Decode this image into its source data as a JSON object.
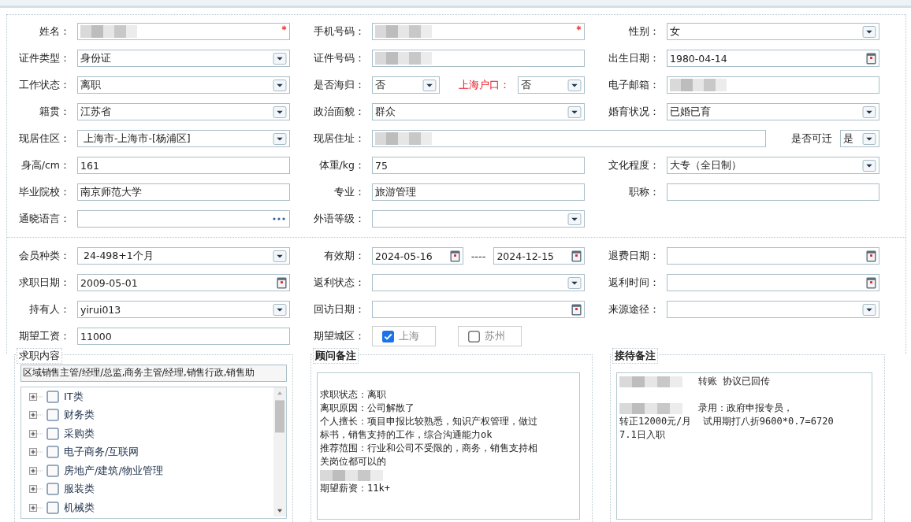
{
  "sections": [
    {
      "rows": [
        {
          "cells": [
            {
              "label": "姓名：",
              "controls": [
                {
                  "kind": "text",
                  "redacted": true,
                  "required": true
                }
              ]
            },
            {
              "label": "手机号码：",
              "controls": [
                {
                  "kind": "text",
                  "redacted": true,
                  "required": true
                }
              ]
            },
            {
              "label": "性别：",
              "controls": [
                {
                  "kind": "select",
                  "value": "女"
                }
              ]
            }
          ]
        },
        {
          "cells": [
            {
              "label": "证件类型：",
              "controls": [
                {
                  "kind": "select",
                  "value": "身份证"
                }
              ]
            },
            {
              "label": "证件号码：",
              "controls": [
                {
                  "kind": "text",
                  "redacted": true
                }
              ]
            },
            {
              "label": "出生日期：",
              "controls": [
                {
                  "kind": "date",
                  "value": "1980-04-14"
                }
              ]
            }
          ]
        },
        {
          "cells": [
            {
              "label": "工作状态：",
              "controls": [
                {
                  "kind": "select",
                  "value": "离职"
                }
              ]
            },
            {
              "label": "是否海归：",
              "controls": [
                {
                  "kind": "select",
                  "value": "否"
                },
                {
                  "kind": "label",
                  "text": "上海户口：",
                  "warning": true
                },
                {
                  "kind": "select",
                  "value": "否"
                }
              ]
            },
            {
              "label": "电子邮箱：",
              "controls": [
                {
                  "kind": "text",
                  "redacted": true
                }
              ]
            }
          ]
        },
        {
          "cells": [
            {
              "label": "籍贯：",
              "controls": [
                {
                  "kind": "select",
                  "value": "江苏省"
                }
              ]
            },
            {
              "label": "政治面貌：",
              "controls": [
                {
                  "kind": "select",
                  "value": "群众"
                }
              ]
            },
            {
              "label": "婚育状况：",
              "controls": [
                {
                  "kind": "select",
                  "value": "已婚已育"
                }
              ]
            }
          ]
        },
        {
          "cells": [
            {
              "label": "现居住区：",
              "controls": [
                {
                  "kind": "select",
                  "value": " 上海市-上海市-[杨浦区]"
                }
              ]
            },
            {
              "label": "现居住址：",
              "wide": true,
              "controls": [
                {
                  "kind": "text",
                  "redacted": true
                },
                {
                  "kind": "label",
                  "text": "是否可迁",
                  "warning": false
                },
                {
                  "kind": "select",
                  "value": "是"
                }
              ]
            }
          ]
        },
        {
          "cells": [
            {
              "label": "身高/cm：",
              "controls": [
                {
                  "kind": "text",
                  "value": "161"
                }
              ]
            },
            {
              "label": "体重/kg：",
              "controls": [
                {
                  "kind": "text",
                  "value": "75"
                }
              ]
            },
            {
              "label": "文化程度：",
              "controls": [
                {
                  "kind": "select",
                  "value": "大专（全日制）"
                }
              ]
            }
          ]
        },
        {
          "cells": [
            {
              "label": "毕业院校：",
              "controls": [
                {
                  "kind": "text",
                  "value": "南京师范大学"
                }
              ]
            },
            {
              "label": "专业：",
              "controls": [
                {
                  "kind": "text",
                  "value": "旅游管理"
                }
              ]
            },
            {
              "label": "职称：",
              "controls": [
                {
                  "kind": "text"
                }
              ]
            }
          ]
        },
        {
          "cells": [
            {
              "label": "通晓语言：",
              "controls": [
                {
                  "kind": "lookup"
                }
              ]
            },
            {
              "label": "外语等级：",
              "controls": [
                {
                  "kind": "select"
                }
              ]
            }
          ]
        }
      ]
    },
    {
      "rows": [
        {
          "cells": [
            {
              "label": "会员种类：",
              "controls": [
                {
                  "kind": "select",
                  "value": " 24-498+1个月"
                }
              ]
            },
            {
              "label": "有效期：",
              "controls": [
                {
                  "kind": "date",
                  "value": "2024-05-16"
                },
                {
                  "kind": "separator",
                  "text": "----"
                },
                {
                  "kind": "date",
                  "value": "2024-12-15"
                }
              ]
            },
            {
              "label": "退费日期：",
              "controls": [
                {
                  "kind": "date"
                }
              ]
            }
          ]
        },
        {
          "cells": [
            {
              "label": "求职日期：",
              "controls": [
                {
                  "kind": "date",
                  "value": "2009-05-01"
                }
              ]
            },
            {
              "label": "返利状态：",
              "controls": [
                {
                  "kind": "select"
                }
              ]
            },
            {
              "label": "返利时间：",
              "controls": [
                {
                  "kind": "date"
                }
              ]
            }
          ]
        },
        {
          "cells": [
            {
              "label": "持有人：",
              "controls": [
                {
                  "kind": "select",
                  "value": "yirui013"
                }
              ]
            },
            {
              "label": "回访日期：",
              "controls": [
                {
                  "kind": "date"
                }
              ]
            },
            {
              "label": "来源途径：",
              "controls": [
                {
                  "kind": "select"
                }
              ]
            }
          ]
        },
        {
          "cells": [
            {
              "label": "期望工资：",
              "controls": [
                {
                  "kind": "text",
                  "value": "11000"
                }
              ]
            },
            {
              "label": "期望城区：",
              "controls": [
                {
                  "kind": "chip",
                  "text": "上海",
                  "checked": true
                },
                {
                  "kind": "chip",
                  "text": "苏州",
                  "checked": false
                }
              ]
            }
          ]
        }
      ]
    }
  ],
  "panels": [
    {
      "kind": "tree",
      "title": "求职内容",
      "summary": "区域销售主管/经理/总监,商务主管/经理,销售行政,销售助",
      "items": [
        {
          "label": "IT类",
          "checked": false,
          "expanded": false
        },
        {
          "label": "财务类",
          "checked": false,
          "expanded": false
        },
        {
          "label": "采购类",
          "checked": false,
          "expanded": false
        },
        {
          "label": "电子商务/互联网",
          "checked": false,
          "expanded": false
        },
        {
          "label": "房地产/建筑/物业管理",
          "checked": false,
          "expanded": false
        },
        {
          "label": "服装类",
          "checked": false,
          "expanded": false
        },
        {
          "label": "机械类",
          "checked": false,
          "expanded": false
        }
      ]
    },
    {
      "kind": "notes",
      "title": "顾问备注",
      "lines": [
        {
          "kind": "blank"
        },
        {
          "kind": "text",
          "text": "求职状态：离职"
        },
        {
          "kind": "text",
          "text": "离职原因：公司解散了"
        },
        {
          "kind": "text",
          "text": "个人擅长：项目申报比较熟悉，知识产权管理，做过"
        },
        {
          "kind": "text",
          "text": "标书，销售支持的工作，综合沟通能力ok"
        },
        {
          "kind": "text",
          "text": "推荐范围：行业和公司不受限的，商务，销售支持相"
        },
        {
          "kind": "text",
          "text": "关岗位都可以的"
        },
        {
          "kind": "redacted"
        },
        {
          "kind": "text",
          "text": "期望薪资：11k+"
        }
      ]
    },
    {
      "kind": "notes",
      "title": "接待备注",
      "lines": [
        {
          "kind": "redacted",
          "text": "转账 协议已回传"
        },
        {
          "kind": "blank"
        },
        {
          "kind": "redacted",
          "text": "录用：政府申报专员，"
        },
        {
          "kind": "text",
          "text": "转正12000元/月  试用期打八折9600*0.7=6720"
        },
        {
          "kind": "text",
          "text": "7.1日入职"
        }
      ]
    }
  ]
}
